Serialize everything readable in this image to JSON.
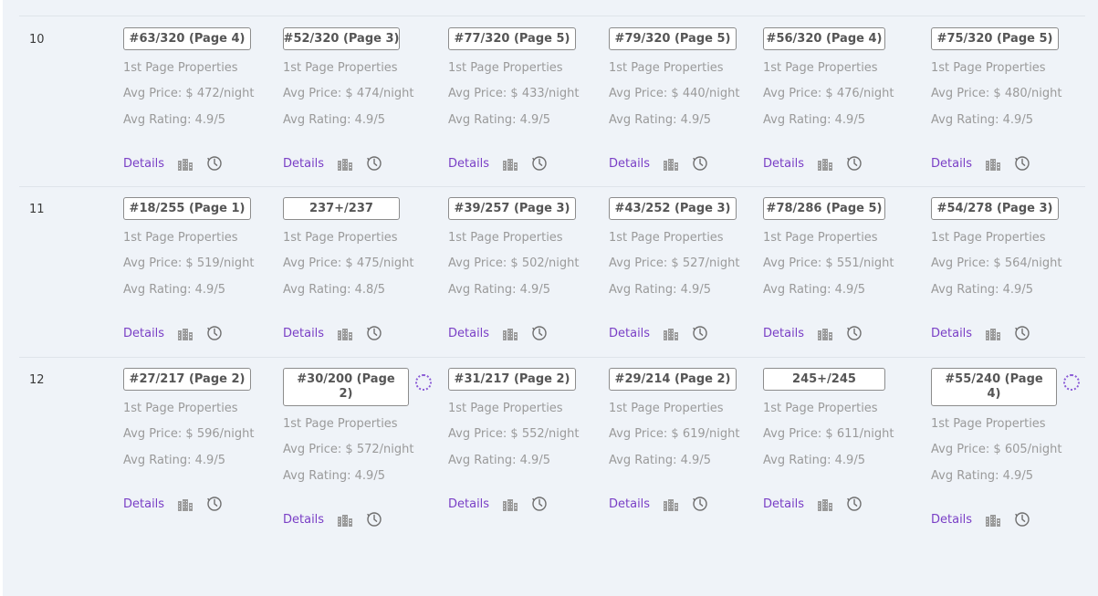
{
  "labels": {
    "first_page": "1st Page Properties",
    "price_prefix": "Avg Price: $ ",
    "price_suffix": "/night",
    "rating_prefix": "Avg Rating: ",
    "rating_suffix": "/5",
    "details": "Details"
  },
  "icons": {
    "building": "building-icon",
    "clock": "clock-history-icon",
    "spinner": "loading-spinner-icon"
  },
  "colors": {
    "accent": "#7a3fc6",
    "muted_text": "#9a9a9a",
    "background": "#eff3f8",
    "icon": "#9b9b9b"
  },
  "rows": [
    {
      "day": "10",
      "cells": [
        {
          "rank": "#63/320 (Page 4)",
          "price": "472",
          "rating": "4.9",
          "loading": false
        },
        {
          "rank": "#52/320 (Page 3)",
          "price": "474",
          "rating": "4.9",
          "loading": false
        },
        {
          "rank": "#77/320 (Page 5)",
          "price": "433",
          "rating": "4.9",
          "loading": false
        },
        {
          "rank": "#79/320 (Page 5)",
          "price": "440",
          "rating": "4.9",
          "loading": false
        },
        {
          "rank": "#56/320 (Page 4)",
          "price": "476",
          "rating": "4.9",
          "loading": false
        },
        {
          "rank": "#75/320 (Page 5)",
          "price": "480",
          "rating": "4.9",
          "loading": false
        }
      ]
    },
    {
      "day": "11",
      "cells": [
        {
          "rank": "#18/255 (Page 1)",
          "price": "519",
          "rating": "4.9",
          "loading": false
        },
        {
          "rank": "237+/237",
          "price": "475",
          "rating": "4.8",
          "loading": false
        },
        {
          "rank": "#39/257 (Page 3)",
          "price": "502",
          "rating": "4.9",
          "loading": false
        },
        {
          "rank": "#43/252 (Page 3)",
          "price": "527",
          "rating": "4.9",
          "loading": false
        },
        {
          "rank": "#78/286 (Page 5)",
          "price": "551",
          "rating": "4.9",
          "loading": false
        },
        {
          "rank": "#54/278 (Page 3)",
          "price": "564",
          "rating": "4.9",
          "loading": false
        }
      ]
    },
    {
      "day": "12",
      "cells": [
        {
          "rank": "#27/217 (Page 2)",
          "price": "596",
          "rating": "4.9",
          "loading": false
        },
        {
          "rank": "#30/200 (Page 2)",
          "price": "572",
          "rating": "4.9",
          "loading": true
        },
        {
          "rank": "#31/217 (Page 2)",
          "price": "552",
          "rating": "4.9",
          "loading": false
        },
        {
          "rank": "#29/214 (Page 2)",
          "price": "619",
          "rating": "4.9",
          "loading": false
        },
        {
          "rank": "245+/245",
          "price": "611",
          "rating": "4.9",
          "loading": false
        },
        {
          "rank": "#55/240 (Page 4)",
          "price": "605",
          "rating": "4.9",
          "loading": true
        }
      ]
    }
  ]
}
